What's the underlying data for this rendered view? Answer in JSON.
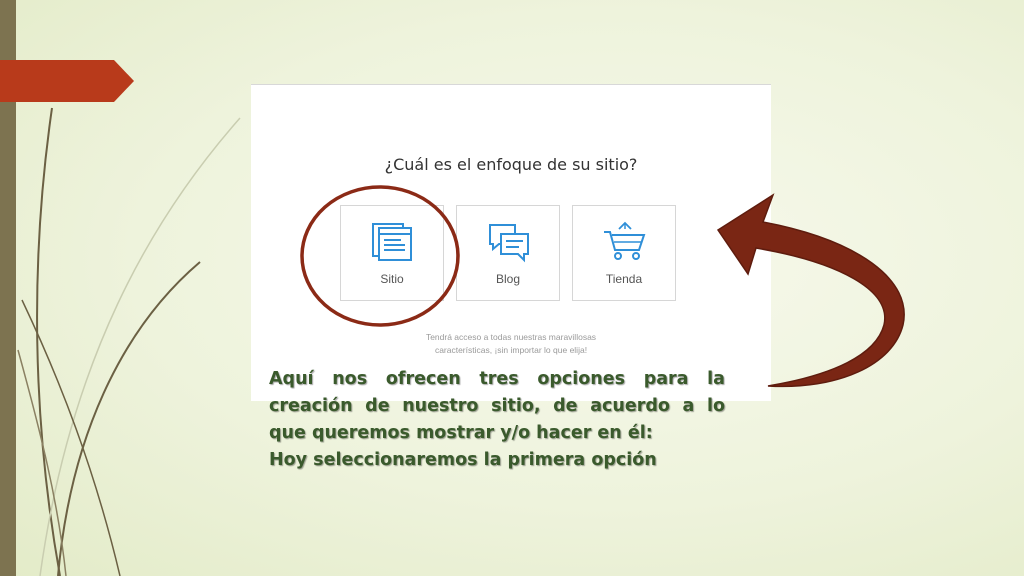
{
  "slide": {
    "screenshot": {
      "question": "¿Cuál es el enfoque de su sitio?",
      "options": [
        {
          "label": "Sitio",
          "icon": "pages-icon"
        },
        {
          "label": "Blog",
          "icon": "chat-bubbles-icon"
        },
        {
          "label": "Tienda",
          "icon": "shopping-cart-icon"
        }
      ],
      "footnote_line1": "Tendrá acceso a todas nuestras maravillosas",
      "footnote_line2": "características, ¡sin importar lo que elija!"
    },
    "caption": {
      "line1": "Aquí  nos ofrecen tres opciones  para la",
      "line2": "creación de nuestro sitio, de acuerdo a lo",
      "line3": "que queremos mostrar y/o hacer en él:",
      "line4": "Hoy seleccionaremos  la primera opción"
    },
    "colors": {
      "accent_red": "#8b2a16",
      "icon_blue": "#2f8fd8",
      "caption_green": "#3a5a2c",
      "left_bar": "#7d7350",
      "tab_red": "#b83a1b"
    }
  }
}
